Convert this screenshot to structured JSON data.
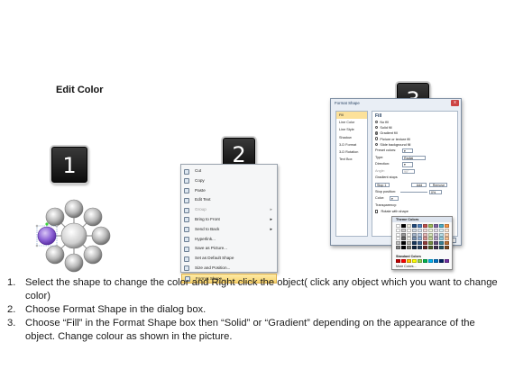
{
  "title": "Edit Color",
  "steps": {
    "s1": "1",
    "s2": "2",
    "s3": "3"
  },
  "context_menu": {
    "items": [
      {
        "label": "Cut",
        "disabled": false,
        "submenu": false
      },
      {
        "label": "Copy",
        "disabled": false,
        "submenu": false
      },
      {
        "label": "Paste",
        "disabled": false,
        "submenu": false
      },
      {
        "label": "Edit Text",
        "disabled": false,
        "submenu": false
      },
      {
        "label": "Group",
        "disabled": true,
        "submenu": true
      },
      {
        "label": "Bring to Front",
        "disabled": false,
        "submenu": true
      },
      {
        "label": "Send to Back",
        "disabled": false,
        "submenu": true
      },
      {
        "label": "Hyperlink...",
        "disabled": false,
        "submenu": false
      },
      {
        "label": "Save as Picture...",
        "disabled": false,
        "submenu": false
      },
      {
        "label": "Set as Default Shape",
        "disabled": false,
        "submenu": false
      },
      {
        "label": "Size and Position...",
        "disabled": false,
        "submenu": false
      },
      {
        "label": "Format Shape...",
        "disabled": false,
        "submenu": false,
        "highlighted": true
      }
    ]
  },
  "dialog": {
    "title": "Format Shape",
    "close": "x",
    "nav": [
      "Fill",
      "Line Color",
      "Line Style",
      "Shadow",
      "3-D Format",
      "3-D Rotation",
      "Text Box"
    ],
    "heading": "Fill",
    "fill_options": [
      "No fill",
      "Solid fill",
      "Gradient fill",
      "Picture or texture fill",
      "Slide background fill"
    ],
    "selected_option": "Gradient fill",
    "labels": {
      "preset": "Preset colors:",
      "type": "Type:",
      "type_value": "Radial",
      "direction": "Direction:",
      "angle": "Angle:",
      "angle_value": "90°",
      "stops": "Gradient stops",
      "stop_value": "Stop 1",
      "add": "Add",
      "remove": "Remove",
      "stop_position": "Stop position:",
      "stop_position_value": "0%",
      "color": "Color:",
      "transparency": "Transparency:",
      "rotate": "Rotate with shape",
      "close_button": "Close"
    }
  },
  "color_popup": {
    "theme_label": "Theme Colors",
    "standard_label": "Standard Colors",
    "more_label": "More Colors...",
    "theme_row": [
      "#ffffff",
      "#000000",
      "#eeece1",
      "#1f497d",
      "#4f81bd",
      "#c0504d",
      "#9bbb59",
      "#8064a2",
      "#4bacc6",
      "#f79646"
    ],
    "standard_row": [
      "#c00000",
      "#ff0000",
      "#ffc000",
      "#ffff00",
      "#92d050",
      "#00b050",
      "#00b0f0",
      "#0070c0",
      "#002060",
      "#7030a0"
    ]
  },
  "instructions": [
    {
      "num": "1.",
      "text": "Select the shape to change the color and Right click the object( click any object which you want to change color)"
    },
    {
      "num": "2.",
      "text": "Choose Format Shape in the dialog box."
    },
    {
      "num": "3.",
      "text": "Choose “Fill” in the Format Shape box then “Solid” or “Gradient” depending on the appearance of the object. Change colour as shown in the picture."
    }
  ]
}
